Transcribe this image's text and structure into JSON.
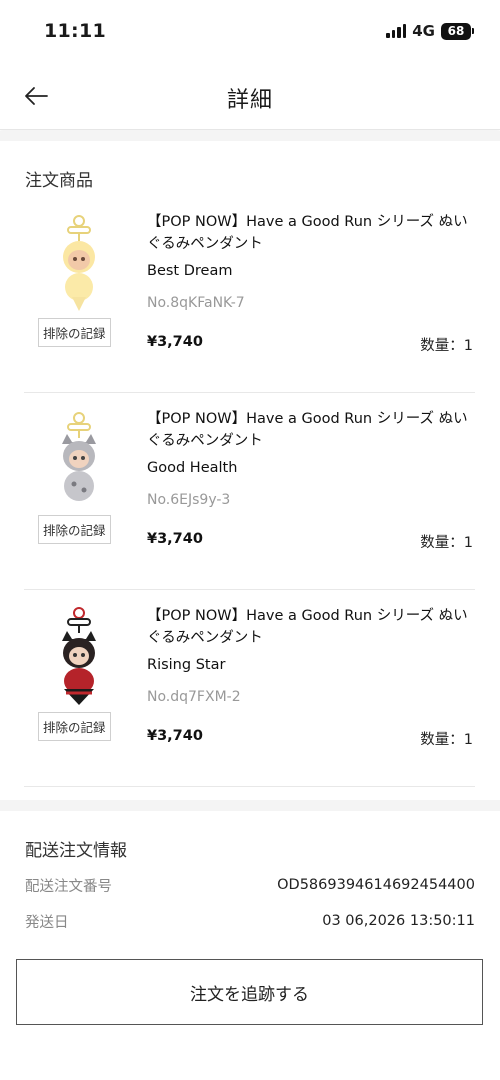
{
  "status_bar": {
    "time": "11:11",
    "network": "4G",
    "battery": "68"
  },
  "header": {
    "title": "詳細",
    "back_icon": "arrow-left-icon"
  },
  "order_items": {
    "section_title": "注文商品",
    "items": [
      {
        "name": "【POP NOW】Have a Good Run シリーズ ぬいぐるみペンダント",
        "variant": "Best Dream",
        "sku": "No.8qKFaNK-7",
        "price": "¥3,740",
        "quantity": "数量：1",
        "remove_label": "排除の記録"
      },
      {
        "name": "【POP NOW】Have a Good Run シリーズ ぬいぐるみペンダント",
        "variant": "Good Health",
        "sku": "No.6EJs9y-3",
        "price": "¥3,740",
        "quantity": "数量：1",
        "remove_label": "排除の記録"
      },
      {
        "name": "【POP NOW】Have a Good Run シリーズ ぬいぐるみペンダント",
        "variant": "Rising Star",
        "sku": "No.dq7FXM-2",
        "price": "¥3,740",
        "quantity": "数量：1",
        "remove_label": "排除の記録"
      }
    ]
  },
  "shipping": {
    "section_title": "配送注文情報",
    "order_number_label": "配送注文番号",
    "order_number": "OD586939461469245440​0",
    "ship_date_label": "発送日",
    "ship_date": "03 06,2026 13:50:11"
  },
  "track_button": "注文を追跡する",
  "colors": {
    "gap_band": "#f4f4f4",
    "muted_text": "#999999",
    "border": "#555555"
  }
}
